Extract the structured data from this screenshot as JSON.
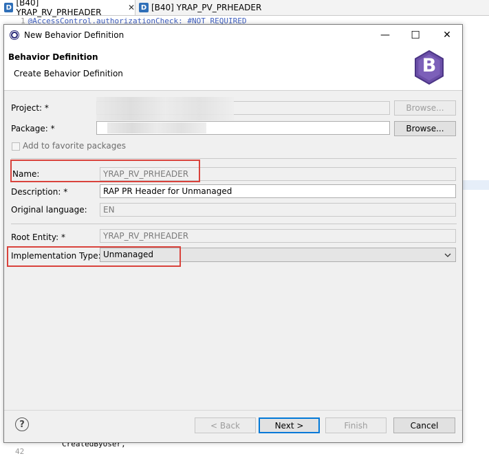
{
  "editor": {
    "tabs": [
      {
        "label": "[B40] YRAP_RV_PRHEADER",
        "close": "✕"
      },
      {
        "label": "[B40] YRAP_PV_PRHEADER"
      }
    ],
    "tab_icon_letter": "D",
    "code_line_number": "1",
    "code_line": "@AccessControl.authorizationCheck: #NOT_REQUIRED",
    "bottom_line_number": "42",
    "bottom_code": "CreatedByUser,"
  },
  "dialog": {
    "title": "New Behavior Definition",
    "minimize": "—",
    "maximize": "☐",
    "close": "✕",
    "header_title": "Behavior Definition",
    "header_subtitle": "Create Behavior Definition",
    "logo_letter": "B",
    "form": {
      "project_label": "Project: *",
      "project_value": "",
      "project_browse": "Browse...",
      "package_label": "Package: *",
      "package_value": "",
      "package_browse": "Browse...",
      "favorite_label": "Add to favorite packages",
      "name_label": "Name:",
      "name_value": "YRAP_RV_PRHEADER",
      "description_label": "Description: *",
      "description_value": "RAP PR Header for Unmanaged",
      "orig_lang_label": "Original language:",
      "orig_lang_value": "EN",
      "root_entity_label": "Root Entity: *",
      "root_entity_value": "YRAP_RV_PRHEADER",
      "impl_type_label": "Implementation Type: *",
      "impl_type_value": "Unmanaged"
    },
    "buttons": {
      "back": "< Back",
      "next": "Next >",
      "finish": "Finish",
      "cancel": "Cancel"
    },
    "help": "?"
  },
  "colors": {
    "highlight": "#d9423b",
    "logo": "#6b4fa8",
    "primary_border": "#0078d7"
  }
}
